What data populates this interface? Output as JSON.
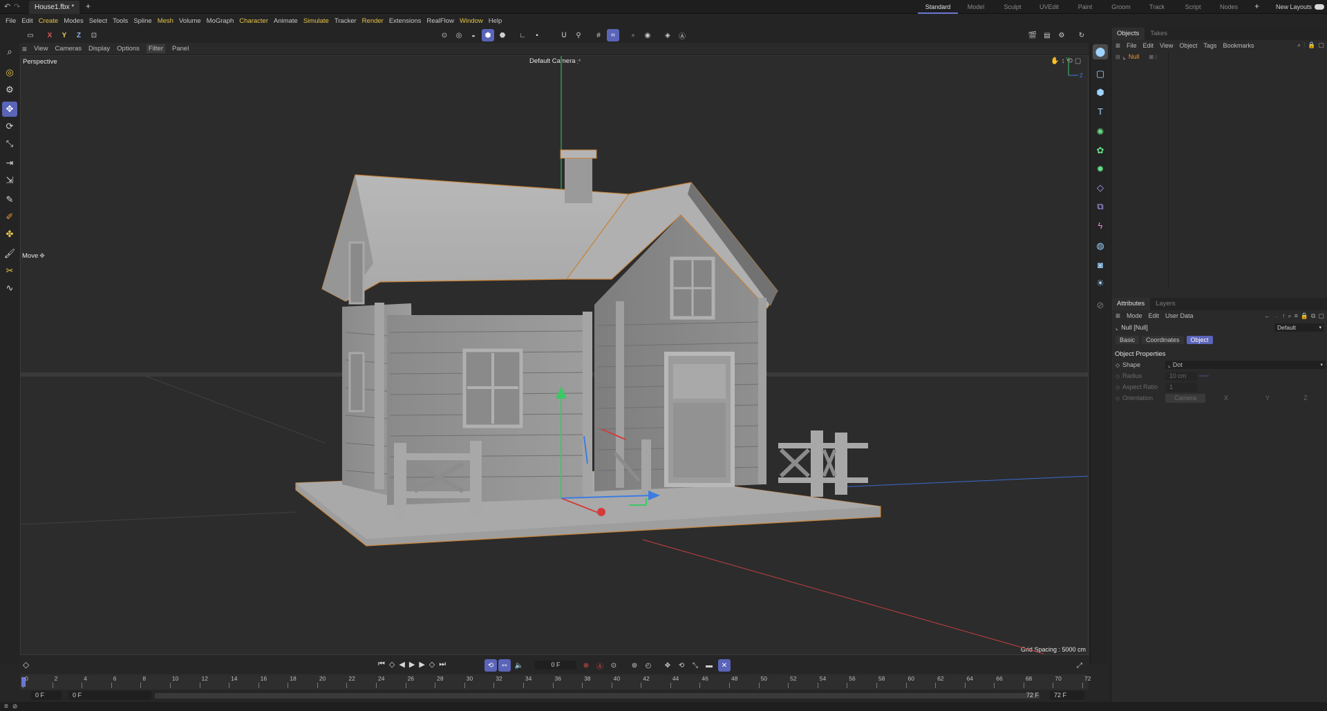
{
  "titlebar": {
    "file_tab": "House1.fbx *",
    "layouts": [
      "Standard",
      "Model",
      "Sculpt",
      "UVEdit",
      "Paint",
      "Groom",
      "Track",
      "Script",
      "Nodes"
    ],
    "active_layout": "Standard",
    "new_layouts": "New Layouts"
  },
  "menu": [
    "File",
    "Edit",
    "Create",
    "Modes",
    "Select",
    "Tools",
    "Spline",
    "Mesh",
    "Volume",
    "MoGraph",
    "Character",
    "Animate",
    "Simulate",
    "Tracker",
    "Render",
    "Extensions",
    "RealFlow",
    "Window",
    "Help"
  ],
  "menu_highlight": [
    "Create",
    "Mesh",
    "Character",
    "Simulate",
    "Render",
    "Window"
  ],
  "axis_buttons": {
    "x": "X",
    "y": "Y",
    "z": "Z"
  },
  "viewport_menu": [
    "View",
    "Cameras",
    "Display",
    "Options",
    "Filter",
    "Panel"
  ],
  "viewport": {
    "label": "Perspective",
    "camera": "Default Camera",
    "camera_suffix": ":*",
    "tool_label": "Move",
    "grid_spacing": "Grid Spacing : 5000 cm"
  },
  "objects_panel": {
    "tabs": [
      "Objects",
      "Takes"
    ],
    "menu": [
      "File",
      "Edit",
      "View",
      "Object",
      "Tags",
      "Bookmarks"
    ],
    "items": [
      {
        "name": "Null"
      }
    ]
  },
  "attributes_panel": {
    "tabs": [
      "Attributes",
      "Layers"
    ],
    "menu": [
      "Mode",
      "Edit",
      "User Data"
    ],
    "object_name": "Null [Null]",
    "preset": "Default",
    "subtabs": [
      "Basic",
      "Coordinates",
      "Object"
    ],
    "active_subtab": "Object",
    "section": "Object Properties",
    "props": {
      "shape_label": "Shape",
      "shape_value": "Dot",
      "radius_label": "Radius",
      "radius_value": "10 cm",
      "aspect_label": "Aspect Ratio",
      "aspect_value": "1",
      "orientation_label": "Orientation",
      "orientation_value": "Camera",
      "orientation_axes": [
        "X",
        "Y",
        "Z"
      ]
    }
  },
  "timeline": {
    "current_frame": "0 F",
    "ticks": [
      "0",
      "2",
      "4",
      "6",
      "8",
      "10",
      "12",
      "14",
      "16",
      "18",
      "20",
      "22",
      "24",
      "26",
      "28",
      "30",
      "32",
      "34",
      "36",
      "38",
      "40",
      "42",
      "44",
      "46",
      "48",
      "50",
      "52",
      "54",
      "56",
      "58",
      "60",
      "62",
      "64",
      "66",
      "68",
      "70",
      "72"
    ],
    "start_field": "0 F",
    "start_field2": "0 F",
    "end_field": "72 F",
    "end_field2": "72 F"
  },
  "colors": {
    "accent": "#5a64b8",
    "selection_outline": "#c8833a",
    "x_axis": "#d23c3c",
    "y_axis": "#3cc864",
    "z_axis": "#3c7ce0"
  }
}
